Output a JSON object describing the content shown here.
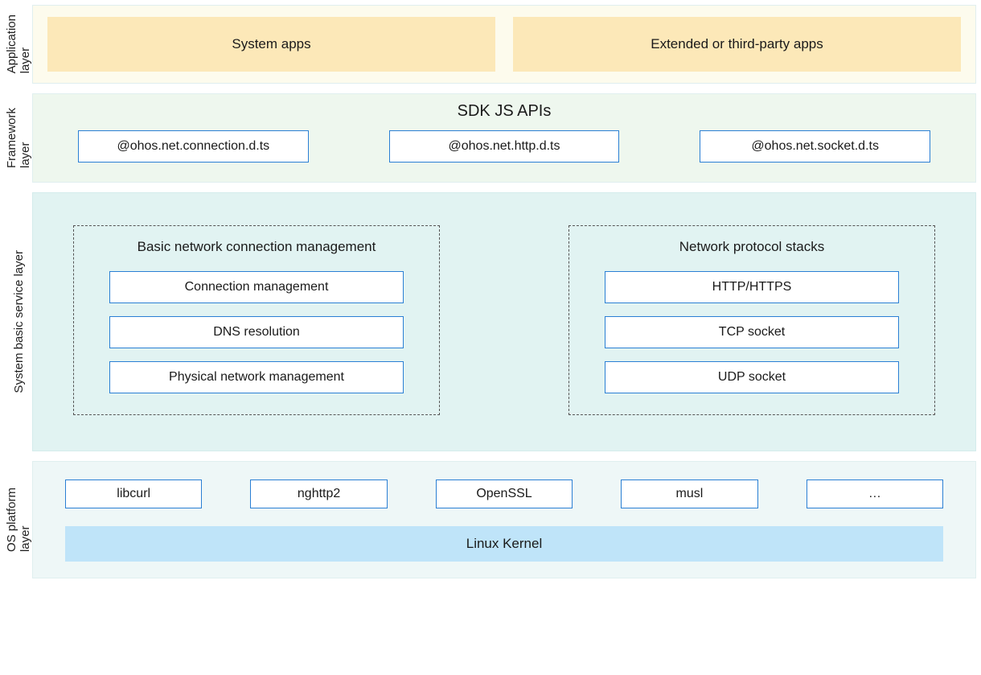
{
  "layers": {
    "application": {
      "label": "Application\nlayer",
      "boxes": [
        "System apps",
        "Extended or third-party apps"
      ]
    },
    "framework": {
      "label": "Framework\nlayer",
      "title": "SDK JS APIs",
      "apis": [
        "@ohos.net.connection.d.ts",
        "@ohos.net.http.d.ts",
        "@ohos.net.socket.d.ts"
      ]
    },
    "service": {
      "label": "System basic service layer",
      "groups": [
        {
          "title": "Basic network connection management",
          "items": [
            "Connection management",
            "DNS resolution",
            "Physical network management"
          ]
        },
        {
          "title": "Network protocol stacks",
          "items": [
            "HTTP/HTTPS",
            "TCP socket",
            "UDP socket"
          ]
        }
      ]
    },
    "os": {
      "label": "OS platform\nlayer",
      "libs": [
        "libcurl",
        "nghttp2",
        "OpenSSL",
        "musl",
        "…"
      ],
      "kernel": "Linux  Kernel"
    }
  }
}
